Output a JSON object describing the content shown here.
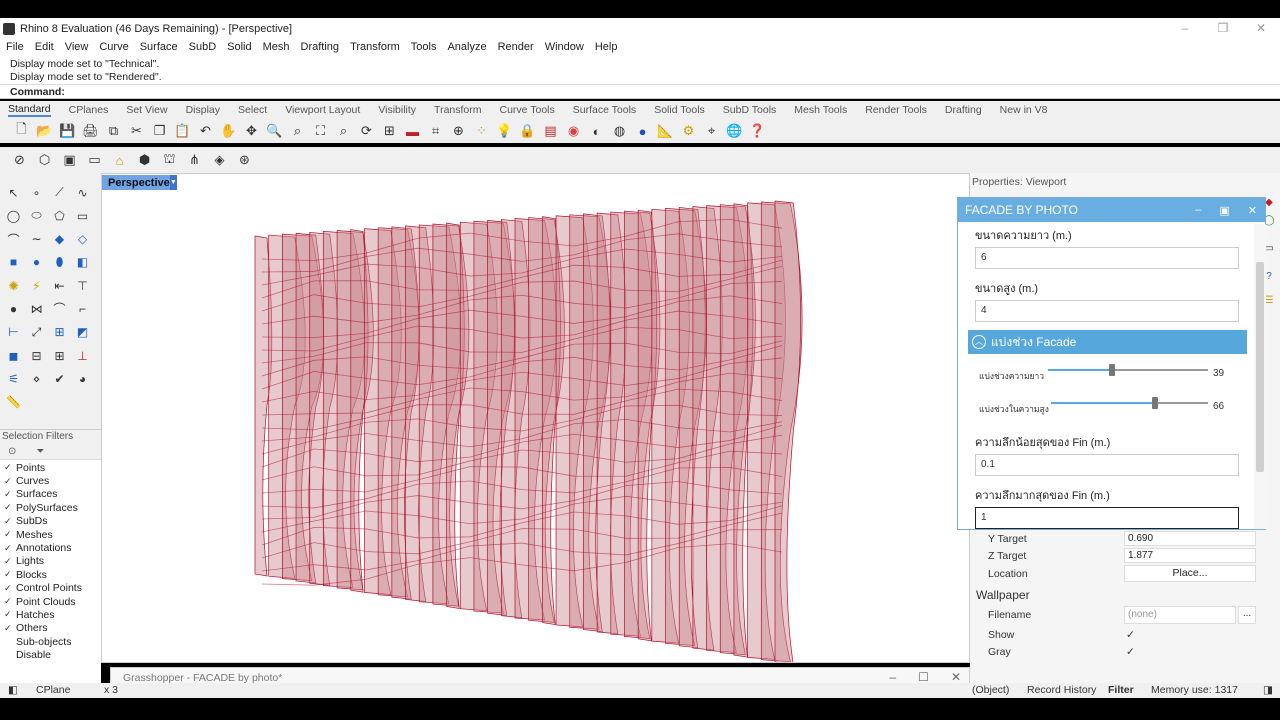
{
  "window": {
    "title": "Rhino 8 Evaluation (46 Days Remaining) - [Perspective]",
    "controls": [
      "–",
      "❐",
      "✕"
    ]
  },
  "menu": [
    "File",
    "Edit",
    "View",
    "Curve",
    "Surface",
    "SubD",
    "Solid",
    "Mesh",
    "Drafting",
    "Transform",
    "Tools",
    "Analyze",
    "Render",
    "Window",
    "Help"
  ],
  "command_history": [
    "Display mode set to \"Technical\".",
    "Display mode set to \"Rendered\"."
  ],
  "command_prompt": "Command:",
  "toolbar_tabs": [
    "Standard",
    "CPlanes",
    "Set View",
    "Display",
    "Select",
    "Viewport Layout",
    "Visibility",
    "Transform",
    "Curve Tools",
    "Surface Tools",
    "Solid Tools",
    "SubD Tools",
    "Mesh Tools",
    "Render Tools",
    "Drafting",
    "New in V8"
  ],
  "active_tab": "Standard",
  "viewport": {
    "tab_label": "Perspective",
    "tab_arrow": "▼"
  },
  "selection_filters": {
    "title": "Selection Filters",
    "items": [
      {
        "label": "Points",
        "checked": "✓"
      },
      {
        "label": "Curves",
        "checked": "✓"
      },
      {
        "label": "Surfaces",
        "checked": "✓"
      },
      {
        "label": "PolySurfaces",
        "checked": "✓"
      },
      {
        "label": "SubDs",
        "checked": "✓"
      },
      {
        "label": "Meshes",
        "checked": "✓"
      },
      {
        "label": "Annotations",
        "checked": "✓"
      },
      {
        "label": "Lights",
        "checked": "✓"
      },
      {
        "label": "Blocks",
        "checked": "✓"
      },
      {
        "label": "Control Points",
        "checked": "✓"
      },
      {
        "label": "Point Clouds",
        "checked": "✓"
      },
      {
        "label": "Hatches",
        "checked": "✓"
      },
      {
        "label": "Others",
        "checked": "✓"
      },
      {
        "label": "Sub-objects",
        "checked": ""
      },
      {
        "label": "Disable",
        "checked": ""
      }
    ]
  },
  "properties": {
    "title": "Properties: Viewport",
    "y_target_label": "Y Target",
    "y_target": "0.690",
    "z_target_label": "Z Target",
    "z_target": "1.877",
    "location_label": "Location",
    "location_button": "Place...",
    "wallpaper_title": "Wallpaper",
    "filename_label": "Filename",
    "filename_value": "(none)",
    "filename_browse": "...",
    "show_label": "Show",
    "show_value": "✓",
    "gray_label": "Gray",
    "gray_value": "✓"
  },
  "facade": {
    "title": "FACADE BY PHOTO",
    "controls": [
      "–",
      "▣",
      "✕"
    ],
    "length_label": "ขนาดความยาว (m.)",
    "length_value": "6",
    "height_label": "ขนาดสูง (m.)",
    "height_value": "4",
    "section_title": "แบ่งช่วง Facade",
    "section_icon": "︿",
    "slider1_label": "แบ่งช่วงความยาว",
    "slider1_value": 39,
    "slider1_fraction": 0.4,
    "slider2_label": "แบ่งช่วงในความสูง",
    "slider2_value": 66,
    "slider2_fraction": 0.66,
    "min_fin_label": "ความลึกน้อยสุดของ Fin (m.)",
    "min_fin_value": "0.1",
    "max_fin_label": "ความลึกมากสุดของ Fin (m.)",
    "max_fin_value": "1"
  },
  "grasshopper": {
    "title": "Grasshopper - FACADE by photo*",
    "controls": [
      "–",
      "☐",
      "✕"
    ]
  },
  "statusbar": {
    "cplane": "CPlane",
    "x": "x 3",
    "object": "(Object)",
    "record_history": "Record History",
    "filter": "Filter",
    "memory": "Memory use: 1317"
  },
  "colors": {
    "accent": "#69aee0",
    "fin_fill": "#c98a92",
    "fin_stroke": "#b0102a"
  }
}
